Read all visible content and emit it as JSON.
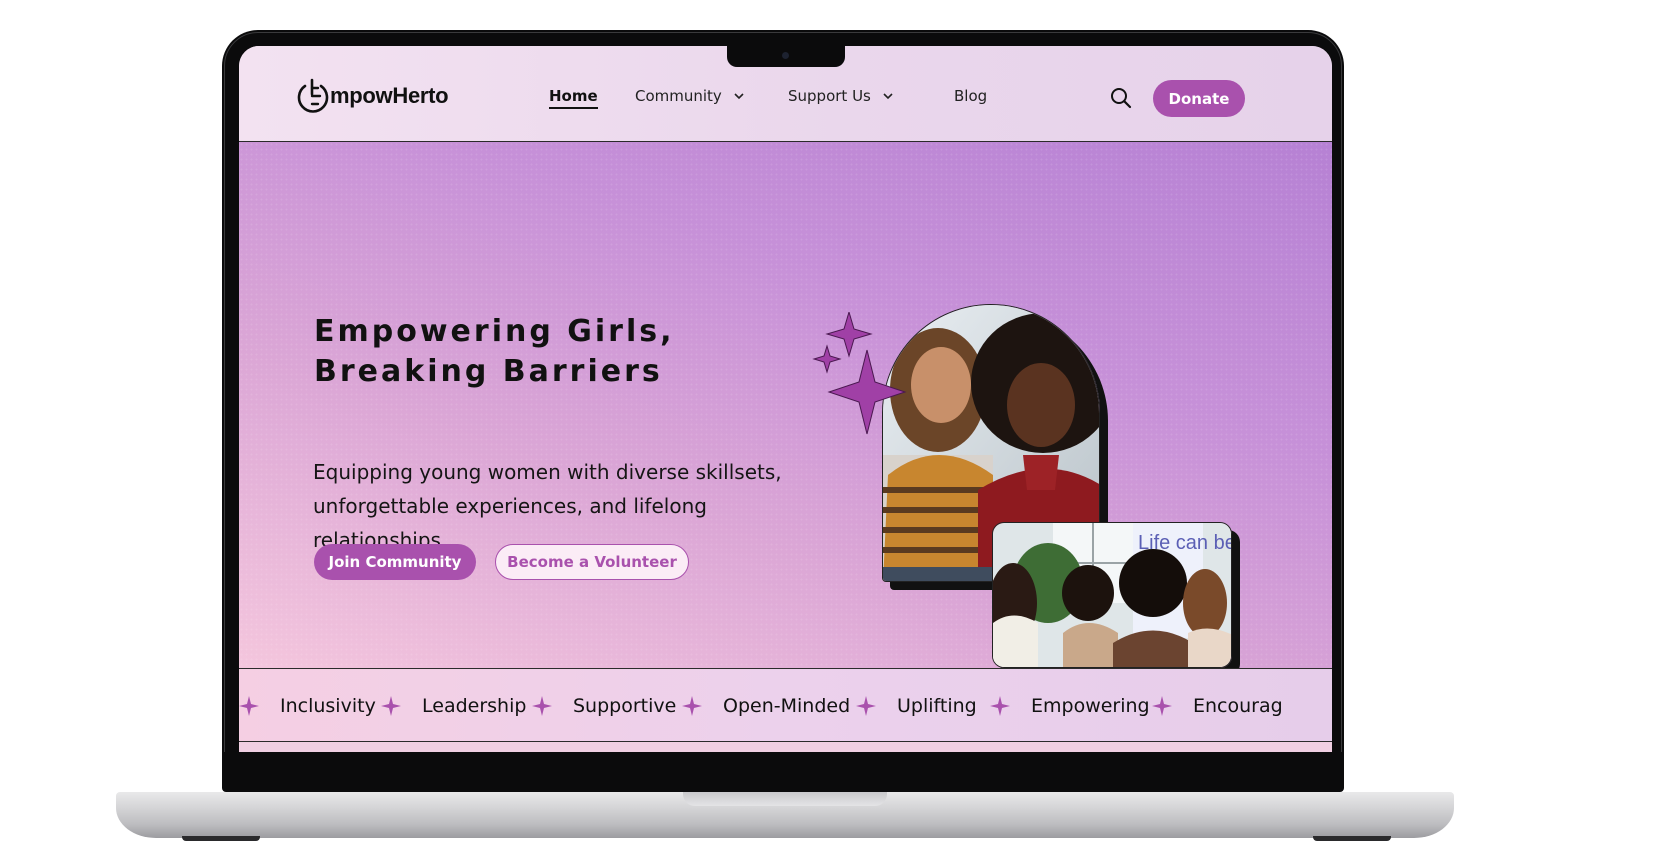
{
  "brand": {
    "name": "mpowHerto",
    "accent": "#a951ad"
  },
  "nav": {
    "items": [
      {
        "label": "Home",
        "active": true,
        "dropdown": false
      },
      {
        "label": "Community",
        "active": false,
        "dropdown": true
      },
      {
        "label": "Support Us",
        "active": false,
        "dropdown": true
      },
      {
        "label": "Blog",
        "active": false,
        "dropdown": false
      }
    ],
    "search_icon": "search-icon",
    "donate_label": "Donate"
  },
  "hero": {
    "title_line1": "Empowering Girls,",
    "title_line2": "Breaking Barriers",
    "subtitle": "Equipping young women with diverse skillsets, unforgettable experiences, and lifelong relationships.",
    "primary_cta": "Join Community",
    "secondary_cta": "Become a Volunteer",
    "photo_sign_text": "Life can be weird"
  },
  "values_marquee": [
    "Inclusivity",
    "Leadership",
    "Supportive",
    "Open-Minded",
    "Uplifting",
    "Empowering",
    "Encourag"
  ]
}
